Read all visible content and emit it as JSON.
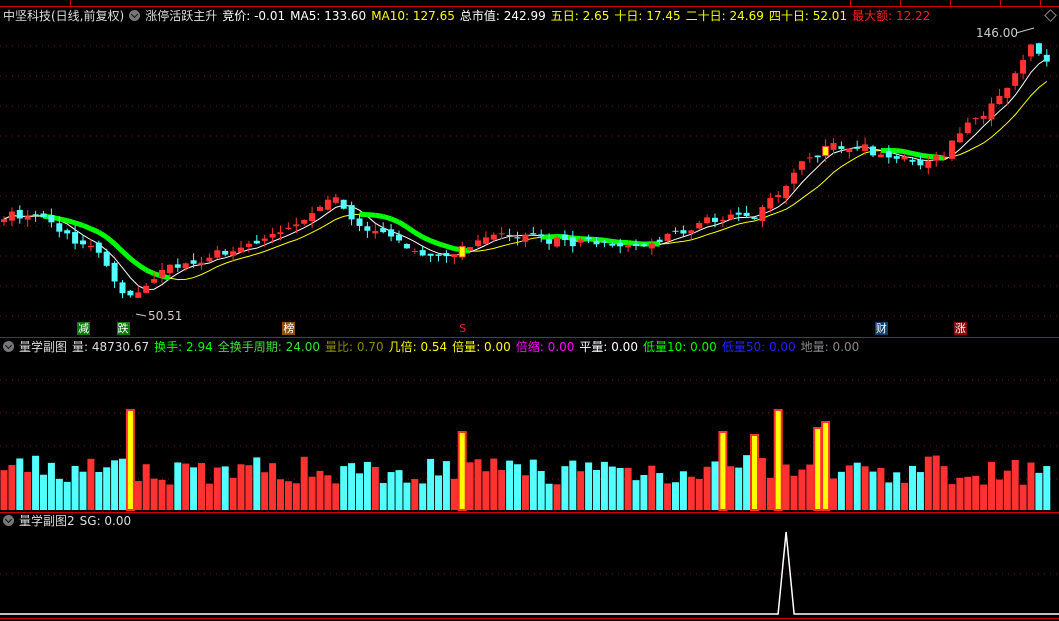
{
  "main_panel": {
    "stock": "中坚科技(日线,前复权)",
    "indicator": "涨停活跃主升",
    "fields": [
      {
        "label": "竞价",
        "value": "-0.01",
        "color": "#ffffff"
      },
      {
        "label": "MA5",
        "value": "133.60",
        "color": "#ffffff"
      },
      {
        "label": "MA10",
        "value": "127.65",
        "color": "#ffff00"
      },
      {
        "label": "总市值",
        "value": "242.99",
        "color": "#ffffff"
      },
      {
        "label": "五日",
        "value": "2.65",
        "color": "#ffff00"
      },
      {
        "label": "十日",
        "value": "17.45",
        "color": "#ffff00"
      },
      {
        "label": "二十日",
        "value": "24.69",
        "color": "#ffff00"
      },
      {
        "label": "四十日",
        "value": "52.01",
        "color": "#ffff00"
      },
      {
        "label": "最大额",
        "value": "12.22",
        "color": "#ff2020"
      }
    ],
    "high_label": "146.00",
    "low_label": "50.51",
    "markers": [
      {
        "text": "减",
        "bar": 10,
        "bg": "#0a7a0a"
      },
      {
        "text": "跌",
        "bar": 15,
        "bg": "#0a7a0a"
      },
      {
        "text": "榜",
        "bar": 36,
        "bg": "#8a5010"
      },
      {
        "text": "S",
        "bar": 58,
        "bg": "none"
      },
      {
        "text": "财",
        "bar": 111,
        "bg": "#123e70"
      },
      {
        "text": "涨",
        "bar": 121,
        "bg": "#8a0a0a"
      }
    ]
  },
  "volume_panel": {
    "title": "量学副图",
    "fields": [
      {
        "label": "量",
        "value": "48730.67",
        "color": "#dddddd"
      },
      {
        "label": "换手",
        "value": "2.94",
        "color": "#00ff00"
      },
      {
        "label": "全换手周期",
        "value": "24.00",
        "color": "#40e040"
      },
      {
        "label": "量比",
        "value": "0.70",
        "color": "#8a8a00"
      },
      {
        "label": "几倍",
        "value": "0.54",
        "color": "#ffff00"
      },
      {
        "label": "倍量",
        "value": "0.00",
        "color": "#ffff00"
      },
      {
        "label": "倍缩",
        "value": "0.00",
        "color": "#ff00ff"
      },
      {
        "label": "平量",
        "value": "0.00",
        "color": "#ffffff"
      },
      {
        "label": "低量10",
        "value": "0.00",
        "color": "#00ff00"
      },
      {
        "label": "低量50",
        "value": "0.00",
        "color": "#2020ff"
      },
      {
        "label": "地量",
        "value": "0.00",
        "color": "#888888"
      }
    ]
  },
  "sg_panel": {
    "title": "量学副图2",
    "fields": [
      {
        "label": "SG",
        "value": "0.00",
        "color": "#dddddd"
      }
    ]
  },
  "chart_data": {
    "type": "candlestick",
    "price_range": [
      50.51,
      146.0
    ],
    "trend_keypoints": [
      [
        0,
        83
      ],
      [
        5,
        82
      ],
      [
        8,
        76
      ],
      [
        12,
        70
      ],
      [
        15,
        55
      ],
      [
        17,
        57
      ],
      [
        20,
        64
      ],
      [
        25,
        68
      ],
      [
        30,
        72
      ],
      [
        36,
        78
      ],
      [
        40,
        86
      ],
      [
        42,
        88
      ],
      [
        45,
        80
      ],
      [
        50,
        73
      ],
      [
        55,
        69
      ],
      [
        58,
        71
      ],
      [
        62,
        75
      ],
      [
        66,
        76
      ],
      [
        70,
        74
      ],
      [
        76,
        73
      ],
      [
        80,
        72
      ],
      [
        84,
        75
      ],
      [
        88,
        80
      ],
      [
        92,
        83
      ],
      [
        95,
        83
      ],
      [
        97,
        88
      ],
      [
        99,
        93
      ],
      [
        101,
        100
      ],
      [
        104,
        106
      ],
      [
        108,
        107
      ],
      [
        111,
        103
      ],
      [
        114,
        102
      ],
      [
        117,
        100
      ],
      [
        119,
        104
      ],
      [
        121,
        112
      ],
      [
        124,
        118
      ],
      [
        126,
        125
      ],
      [
        128,
        130
      ],
      [
        130,
        140
      ],
      [
        131,
        137
      ],
      [
        132,
        135
      ]
    ],
    "volume_spikes": [
      [
        16,
        1.0
      ],
      [
        58,
        0.78
      ],
      [
        91,
        0.78
      ],
      [
        95,
        0.75
      ],
      [
        98,
        1.0
      ],
      [
        103,
        0.82
      ],
      [
        104,
        0.88
      ]
    ],
    "sg_spike_bar": 99,
    "bars": 133
  }
}
